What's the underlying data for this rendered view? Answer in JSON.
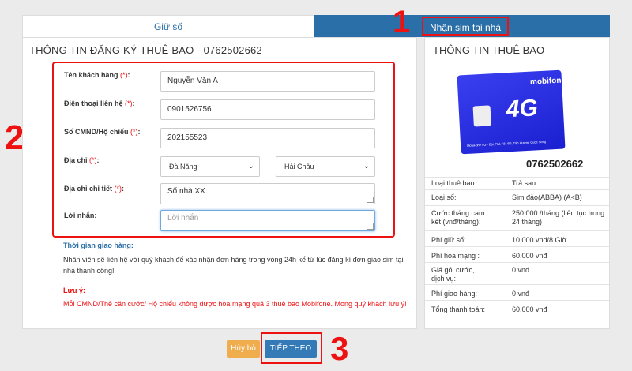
{
  "tabs": {
    "keep_number": "Giữ số",
    "home_delivery": "Nhận sim tại nhà"
  },
  "annotations": {
    "n1": "1",
    "n2": "2",
    "n3": "3"
  },
  "form": {
    "title": "THÔNG TIN ĐĂNG KÝ THUÊ BAO - 0762502662",
    "required_mark": "(*)",
    "name_label": "Tên khách hàng",
    "name_value": "Nguyễn Văn A",
    "phone_label": "Điện thoại liên hệ",
    "phone_value": "0901526756",
    "id_label": "Số CMND/Hộ chiếu",
    "id_value": "202155523",
    "address_label": "Địa chỉ",
    "province_value": "Đà Nẵng",
    "district_value": "Hải Châu",
    "address_detail_label": "Địa chỉ chi tiết",
    "address_detail_value": "Số nhà XX",
    "message_label": "Lời nhắn:",
    "message_placeholder": "Lời nhắn"
  },
  "delivery": {
    "title": "Thời gian giao hàng:",
    "text": "Nhân viên sẽ liên hệ với quý khách để xác nhận đơn hàng trong vòng 24h kể từ lúc đăng kí đơn giao sim tại nhà thành công!"
  },
  "note": {
    "title": "Lưu ý:",
    "text": "Mỗi CMND/Thẻ căn cước/ Hộ chiếu không được hòa mạng quá 3 thuê bao Mobifone. Mong quý khách lưu ý!"
  },
  "subscriber": {
    "title": "THÔNG TIN THUÊ BAO",
    "sim_logo": "mobifone",
    "sim_badge": "4G",
    "sim_footer": "MobiFone 4G - Bứt Phá Tốc Độ, Tận Hưởng Cuộc Sống",
    "number": "0762502662",
    "rows": [
      {
        "key": "Loại thuê bao:",
        "value": "Trả sau"
      },
      {
        "key": "Loại số:",
        "value": "Sim đảo(ABBA) (A<B)"
      },
      {
        "key": "Cước tháng cam kết (vnđ/tháng):",
        "value": "250,000 /tháng (liên tục trong 24 tháng)"
      },
      {
        "key": "Phí giữ số:",
        "value": "10,000 vnđ/8 Giờ"
      },
      {
        "key": "Phí hòa mạng :",
        "value": "60,000 vnđ"
      },
      {
        "key": "Giá gói cước, dịch vụ:",
        "value": "0 vnđ"
      },
      {
        "key": "Phí giao hàng:",
        "value": "0 vnđ"
      },
      {
        "key": "Tổng thanh toán:",
        "value": "60,000 vnđ"
      }
    ]
  },
  "buttons": {
    "cancel": "Hủy bỏ",
    "next": "TIẾP THEO"
  },
  "colors": {
    "primary": "#2a6fa8",
    "accent_red": "#e11111",
    "cancel": "#f0ad4e",
    "next": "#337ab7"
  }
}
